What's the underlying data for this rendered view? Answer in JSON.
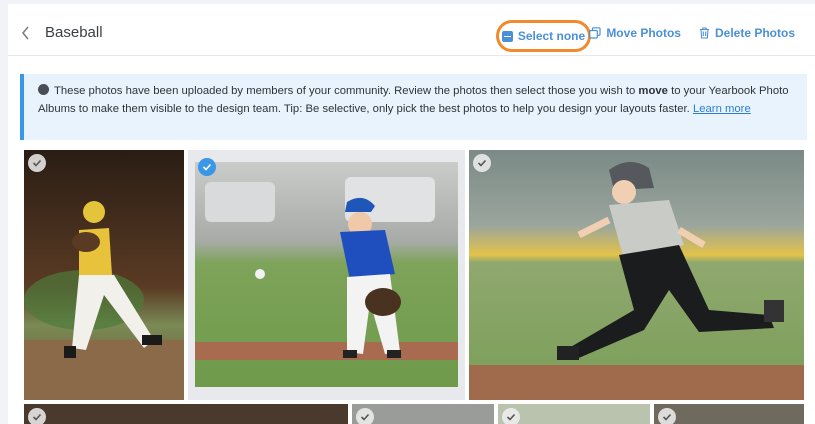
{
  "header": {
    "title": "Baseball",
    "select_none": "Select none",
    "move_photos": "Move Photos",
    "delete_photos": "Delete Photos"
  },
  "notice": {
    "text_before": "These photos have been uploaded by members of your community. Review the photos then select those you wish to ",
    "bold_word": "move",
    "text_after": " to your Yearbook Photo Albums to make them visible to the design team. Tip: Be selective, only pick the best photos to help you design your layouts faster. ",
    "link": "Learn more"
  },
  "photos": [
    {
      "id": "p1",
      "selected": false
    },
    {
      "id": "p2",
      "selected": true
    },
    {
      "id": "p3",
      "selected": false
    }
  ],
  "colors": {
    "accent": "#4a90d9",
    "highlight_ring": "#f08a2c",
    "notice_border": "#3a97e8"
  }
}
